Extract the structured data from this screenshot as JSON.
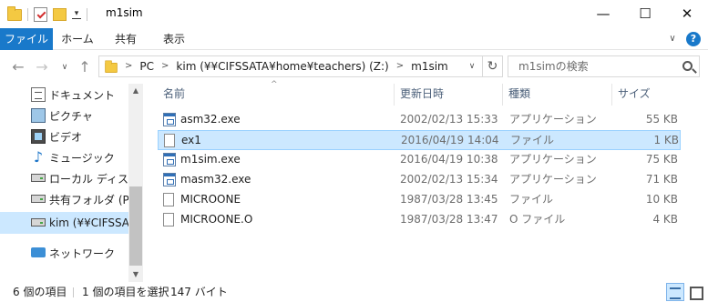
{
  "window": {
    "title": "m1sim",
    "minimize_glyph": "—",
    "maximize_glyph": "☐",
    "close_glyph": "✕"
  },
  "quick_access": {
    "dropdown_glyph": "▾"
  },
  "ribbon": {
    "tabs": [
      "ファイル",
      "ホーム",
      "共有",
      "表示"
    ],
    "expand_glyph": "∨",
    "help_glyph": "?"
  },
  "nav": {
    "back_glyph": "←",
    "forward_glyph": "→",
    "recent_glyph": "∨",
    "up_glyph": "↑"
  },
  "address": {
    "crumbs": [
      "PC",
      "kim (¥¥CIFSSATA¥home¥teachers) (Z:)",
      "m1sim"
    ],
    "sep_glyph": ">",
    "dropdown_glyph": "∨",
    "refresh_glyph": "↻"
  },
  "search": {
    "placeholder": "m1simの検索"
  },
  "nav_pane": {
    "items": [
      {
        "label": "ドキュメント",
        "icon": "documents-icon"
      },
      {
        "label": "ピクチャ",
        "icon": "pictures-icon"
      },
      {
        "label": "ビデオ",
        "icon": "videos-icon"
      },
      {
        "label": "ミュージック",
        "icon": "music-icon"
      },
      {
        "label": "ローカル ディスク (C",
        "icon": "local-disk-icon"
      },
      {
        "label": "共有フォルダ (P:)",
        "icon": "network-drive-icon"
      },
      {
        "label": "kim (¥¥CIFSSATA",
        "icon": "network-drive-icon",
        "selected": true
      },
      {
        "label": "ネットワーク",
        "icon": "network-icon"
      }
    ],
    "music_glyph": "♪",
    "scroll_up_glyph": "▲",
    "scroll_down_glyph": "▼"
  },
  "columns": {
    "name": "名前",
    "date": "更新日時",
    "type": "種類",
    "size": "サイズ",
    "sort_glyph": "^"
  },
  "files": [
    {
      "name": "asm32.exe",
      "date": "2002/02/13 15:33",
      "type": "アプリケーション",
      "size": "55 KB",
      "icon": "exe"
    },
    {
      "name": "ex1",
      "date": "2016/04/19 14:04",
      "type": "ファイル",
      "size": "1 KB",
      "icon": "file",
      "selected": true
    },
    {
      "name": "m1sim.exe",
      "date": "2016/04/19 10:38",
      "type": "アプリケーション",
      "size": "75 KB",
      "icon": "exe"
    },
    {
      "name": "masm32.exe",
      "date": "2002/02/13 15:34",
      "type": "アプリケーション",
      "size": "71 KB",
      "icon": "exe"
    },
    {
      "name": "MICROONE",
      "date": "1987/03/28 13:45",
      "type": "ファイル",
      "size": "10 KB",
      "icon": "file"
    },
    {
      "name": "MICROONE.O",
      "date": "1987/03/28 13:47",
      "type": "O ファイル",
      "size": "4 KB",
      "icon": "file"
    }
  ],
  "status": {
    "item_count": "6 個の項目",
    "selection": "1 個の項目を選択",
    "selection_size": "147 バイト"
  },
  "colors": {
    "accent": "#1979ca",
    "selection": "#cce8ff",
    "selection_border": "#99d1ff"
  }
}
